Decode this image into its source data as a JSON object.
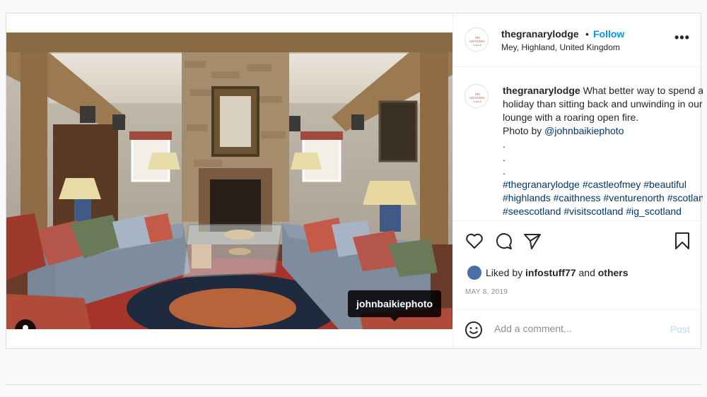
{
  "post": {
    "username": "thegranarylodge",
    "dot": "•",
    "follow_label": "Follow",
    "location": "Mey, Highland, United Kingdom",
    "more_label": "•••",
    "avatar_text": "THE GRANARY LODGE",
    "photo": {
      "tag_label": "johnbaikiephoto",
      "user_tag_icon": "person-icon"
    },
    "caption": {
      "username": "thegranarylodge",
      "line1": "What better way to spend a",
      "line2": "holiday than sitting back and unwinding in our",
      "line3": "lounge with a roaring open fire.",
      "photo_by": "Photo by ",
      "photo_by_link": "@johnbaikiephoto",
      "dots": [
        ".",
        ".",
        "."
      ],
      "tags_line1": "#thegranarylodge #castleofmey #beautiful",
      "tags_line2": "#highlands #caithness #venturenorth #scotland",
      "tags_line3": "#seescotland #visitscotland #ig_scotland"
    },
    "actions": {
      "like_icon": "heart-icon",
      "comment_icon": "comment-icon",
      "share_icon": "paper-plane-icon",
      "save_icon": "bookmark-icon"
    },
    "liked": {
      "prefix": "Liked by ",
      "user": "infostuff77",
      "middle": " and ",
      "others": "others"
    },
    "date": "MAY 8, 2019",
    "comment": {
      "placeholder": "Add a comment...",
      "post_label": "Post",
      "emoji_icon": "smiley-icon"
    }
  }
}
